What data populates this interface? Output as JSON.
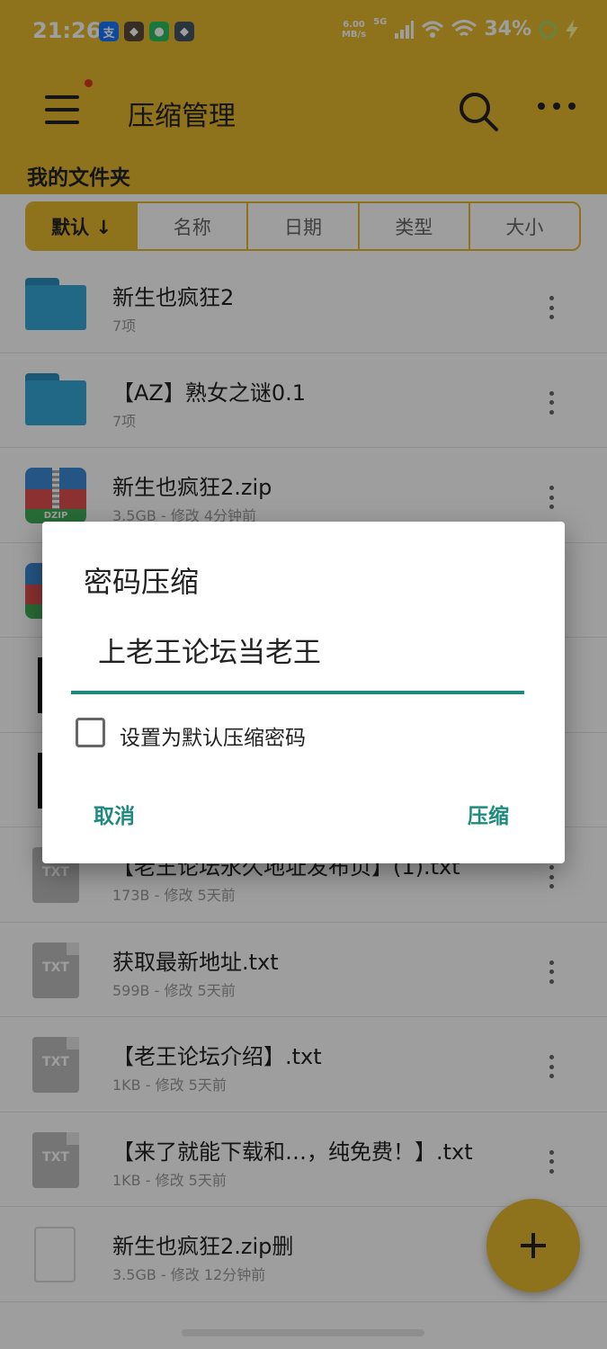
{
  "status": {
    "time": "21:26",
    "apps": [
      {
        "name": "alipay-icon",
        "glyph": "支",
        "color": "#1677ff"
      },
      {
        "name": "game-app-icon",
        "glyph": "◆",
        "color": "#5a4a3a"
      },
      {
        "name": "wechat-icon",
        "glyph": "●",
        "color": "#2ac15f"
      },
      {
        "name": "game-app-2-icon",
        "glyph": "◆",
        "color": "#445566"
      }
    ],
    "net_speed_value": "6.00",
    "net_speed_unit": "MB/s",
    "network": "5G",
    "battery": "34%"
  },
  "appbar": {
    "title": "压缩管理",
    "breadcrumb": "我的文件夹"
  },
  "sort_tabs": [
    {
      "label": "默认 ↓",
      "active": true
    },
    {
      "label": "名称",
      "active": false
    },
    {
      "label": "日期",
      "active": false
    },
    {
      "label": "类型",
      "active": false
    },
    {
      "label": "大小",
      "active": false
    }
  ],
  "files": [
    {
      "type": "folder",
      "name": "新生也疯狂2",
      "meta": "7项"
    },
    {
      "type": "folder",
      "name": "【AZ】熟女之谜0.1",
      "meta": "7项"
    },
    {
      "type": "zip",
      "name": "新生也疯狂2.zip",
      "meta": "3.5GB - 修改 4分钟前",
      "icon_label": "DZIP"
    },
    {
      "type": "zip",
      "name": "",
      "meta": "",
      "icon_label": ""
    },
    {
      "type": "black",
      "name": "",
      "meta": ""
    },
    {
      "type": "black",
      "name": "",
      "meta": ""
    },
    {
      "type": "txt",
      "name": "【老王论坛永久地址发布页】(1).txt",
      "meta": "173B - 修改 5天前",
      "icon_label": "TXT"
    },
    {
      "type": "txt",
      "name": "获取最新地址.txt",
      "meta": "599B - 修改 5天前",
      "icon_label": "TXT"
    },
    {
      "type": "txt",
      "name": "【老王论坛介绍】.txt",
      "meta": "1KB - 修改 5天前",
      "icon_label": "TXT"
    },
    {
      "type": "txt",
      "name": "【来了就能下载和…，纯免费！】.txt",
      "meta": "1KB - 修改 5天前",
      "icon_label": "TXT"
    },
    {
      "type": "doc",
      "name": "新生也疯狂2.zip删",
      "meta": "3.5GB - 修改 12分钟前"
    }
  ],
  "dialog": {
    "title": "密码压缩",
    "password_value": "上老王论坛当老王",
    "checkbox_label": "设置为默认压缩密码",
    "cancel_label": "取消",
    "ok_label": "压缩"
  },
  "colors": {
    "primary": "#e5b92e",
    "accent": "#1e8a7e"
  }
}
